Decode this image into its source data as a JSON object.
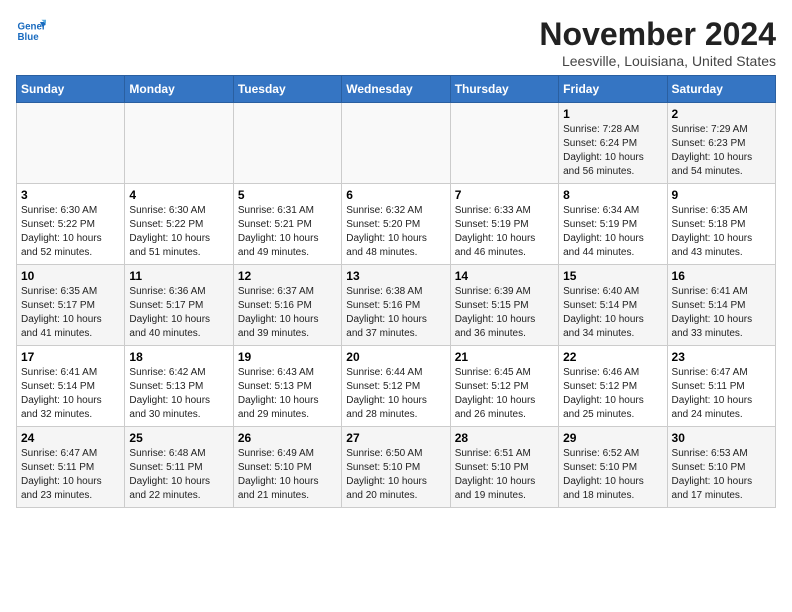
{
  "logo": {
    "line1": "General",
    "line2": "Blue"
  },
  "title": "November 2024",
  "location": "Leesville, Louisiana, United States",
  "days_header": [
    "Sunday",
    "Monday",
    "Tuesday",
    "Wednesday",
    "Thursday",
    "Friday",
    "Saturday"
  ],
  "weeks": [
    [
      {
        "day": "",
        "info": ""
      },
      {
        "day": "",
        "info": ""
      },
      {
        "day": "",
        "info": ""
      },
      {
        "day": "",
        "info": ""
      },
      {
        "day": "",
        "info": ""
      },
      {
        "day": "1",
        "info": "Sunrise: 7:28 AM\nSunset: 6:24 PM\nDaylight: 10 hours and 56 minutes."
      },
      {
        "day": "2",
        "info": "Sunrise: 7:29 AM\nSunset: 6:23 PM\nDaylight: 10 hours and 54 minutes."
      }
    ],
    [
      {
        "day": "3",
        "info": "Sunrise: 6:30 AM\nSunset: 5:22 PM\nDaylight: 10 hours and 52 minutes."
      },
      {
        "day": "4",
        "info": "Sunrise: 6:30 AM\nSunset: 5:22 PM\nDaylight: 10 hours and 51 minutes."
      },
      {
        "day": "5",
        "info": "Sunrise: 6:31 AM\nSunset: 5:21 PM\nDaylight: 10 hours and 49 minutes."
      },
      {
        "day": "6",
        "info": "Sunrise: 6:32 AM\nSunset: 5:20 PM\nDaylight: 10 hours and 48 minutes."
      },
      {
        "day": "7",
        "info": "Sunrise: 6:33 AM\nSunset: 5:19 PM\nDaylight: 10 hours and 46 minutes."
      },
      {
        "day": "8",
        "info": "Sunrise: 6:34 AM\nSunset: 5:19 PM\nDaylight: 10 hours and 44 minutes."
      },
      {
        "day": "9",
        "info": "Sunrise: 6:35 AM\nSunset: 5:18 PM\nDaylight: 10 hours and 43 minutes."
      }
    ],
    [
      {
        "day": "10",
        "info": "Sunrise: 6:35 AM\nSunset: 5:17 PM\nDaylight: 10 hours and 41 minutes."
      },
      {
        "day": "11",
        "info": "Sunrise: 6:36 AM\nSunset: 5:17 PM\nDaylight: 10 hours and 40 minutes."
      },
      {
        "day": "12",
        "info": "Sunrise: 6:37 AM\nSunset: 5:16 PM\nDaylight: 10 hours and 39 minutes."
      },
      {
        "day": "13",
        "info": "Sunrise: 6:38 AM\nSunset: 5:16 PM\nDaylight: 10 hours and 37 minutes."
      },
      {
        "day": "14",
        "info": "Sunrise: 6:39 AM\nSunset: 5:15 PM\nDaylight: 10 hours and 36 minutes."
      },
      {
        "day": "15",
        "info": "Sunrise: 6:40 AM\nSunset: 5:14 PM\nDaylight: 10 hours and 34 minutes."
      },
      {
        "day": "16",
        "info": "Sunrise: 6:41 AM\nSunset: 5:14 PM\nDaylight: 10 hours and 33 minutes."
      }
    ],
    [
      {
        "day": "17",
        "info": "Sunrise: 6:41 AM\nSunset: 5:14 PM\nDaylight: 10 hours and 32 minutes."
      },
      {
        "day": "18",
        "info": "Sunrise: 6:42 AM\nSunset: 5:13 PM\nDaylight: 10 hours and 30 minutes."
      },
      {
        "day": "19",
        "info": "Sunrise: 6:43 AM\nSunset: 5:13 PM\nDaylight: 10 hours and 29 minutes."
      },
      {
        "day": "20",
        "info": "Sunrise: 6:44 AM\nSunset: 5:12 PM\nDaylight: 10 hours and 28 minutes."
      },
      {
        "day": "21",
        "info": "Sunrise: 6:45 AM\nSunset: 5:12 PM\nDaylight: 10 hours and 26 minutes."
      },
      {
        "day": "22",
        "info": "Sunrise: 6:46 AM\nSunset: 5:12 PM\nDaylight: 10 hours and 25 minutes."
      },
      {
        "day": "23",
        "info": "Sunrise: 6:47 AM\nSunset: 5:11 PM\nDaylight: 10 hours and 24 minutes."
      }
    ],
    [
      {
        "day": "24",
        "info": "Sunrise: 6:47 AM\nSunset: 5:11 PM\nDaylight: 10 hours and 23 minutes."
      },
      {
        "day": "25",
        "info": "Sunrise: 6:48 AM\nSunset: 5:11 PM\nDaylight: 10 hours and 22 minutes."
      },
      {
        "day": "26",
        "info": "Sunrise: 6:49 AM\nSunset: 5:10 PM\nDaylight: 10 hours and 21 minutes."
      },
      {
        "day": "27",
        "info": "Sunrise: 6:50 AM\nSunset: 5:10 PM\nDaylight: 10 hours and 20 minutes."
      },
      {
        "day": "28",
        "info": "Sunrise: 6:51 AM\nSunset: 5:10 PM\nDaylight: 10 hours and 19 minutes."
      },
      {
        "day": "29",
        "info": "Sunrise: 6:52 AM\nSunset: 5:10 PM\nDaylight: 10 hours and 18 minutes."
      },
      {
        "day": "30",
        "info": "Sunrise: 6:53 AM\nSunset: 5:10 PM\nDaylight: 10 hours and 17 minutes."
      }
    ]
  ]
}
